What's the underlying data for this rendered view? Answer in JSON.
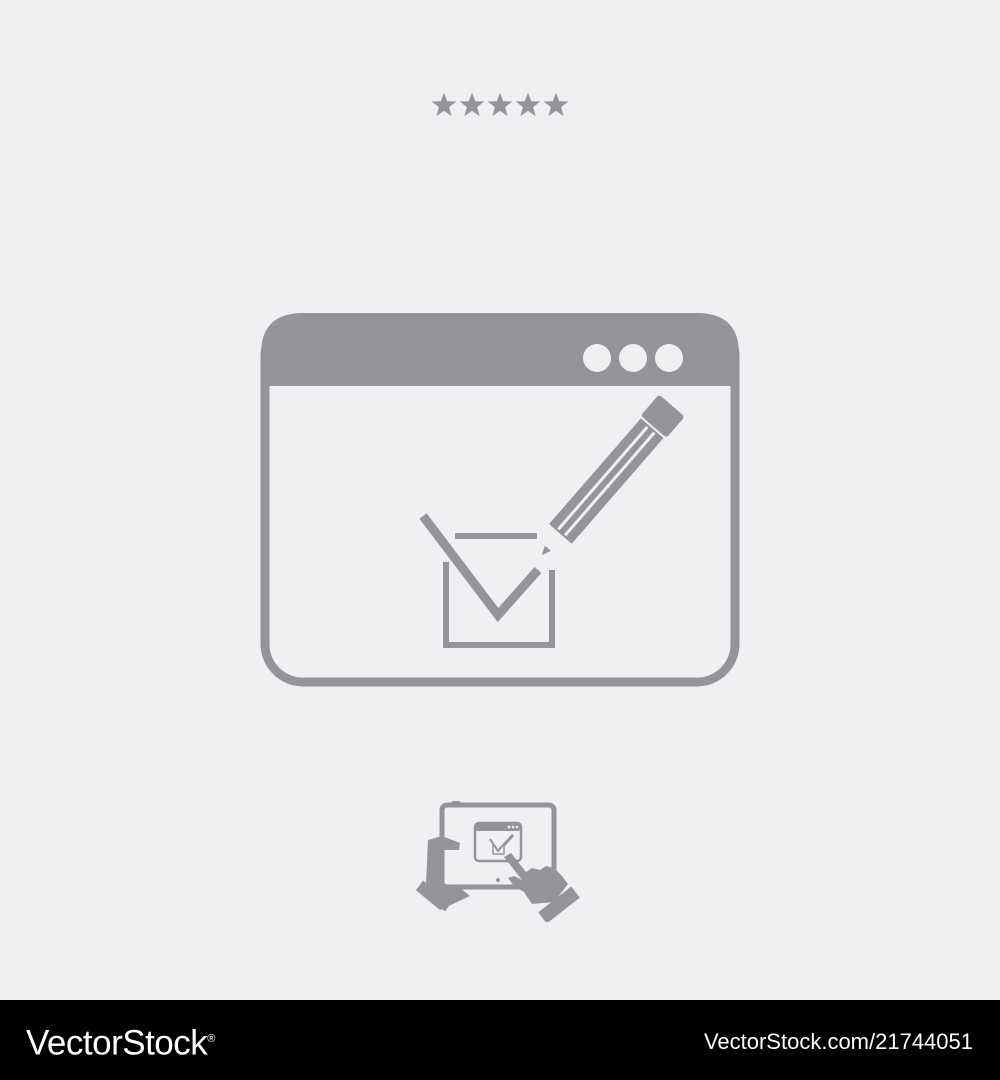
{
  "rating": {
    "stars": 5,
    "max": 5
  },
  "icons": {
    "main": "browser-window-checkbox-pencil-icon",
    "mini": "tablet-hands-touch-icon"
  },
  "footer": {
    "brand": "VectorStock",
    "registered_mark": "®",
    "image_id": "VectorStock.com/21744051"
  },
  "colors": {
    "background": "#eff0f2",
    "icon": "#939598",
    "footer_bg": "#000000",
    "footer_text": "#ffffff"
  }
}
